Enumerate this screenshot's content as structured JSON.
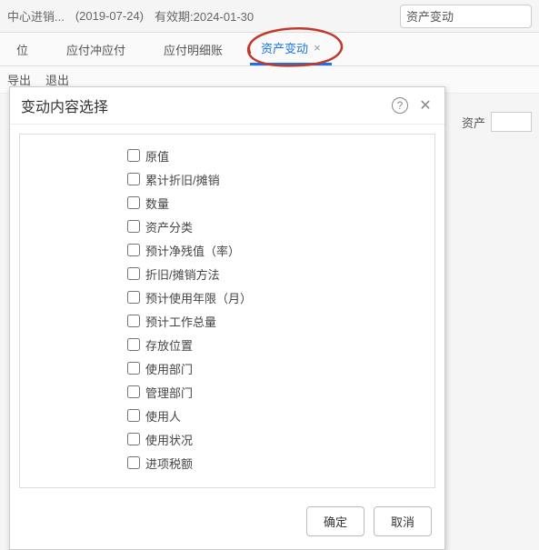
{
  "header": {
    "title_left": "中心进销...",
    "date_paren": "(2019-07-24)",
    "validity": "有效期:2024-01-30",
    "search_value": "资产变动"
  },
  "tabs": [
    {
      "label": "位",
      "active": false,
      "closable": false
    },
    {
      "label": "应付冲应付",
      "active": false,
      "closable": false
    },
    {
      "label": "应付明细账",
      "active": false,
      "closable": false
    },
    {
      "label": "资产变动",
      "active": true,
      "closable": true
    }
  ],
  "subbar": {
    "item1": "导出",
    "item2": "退出"
  },
  "form": {
    "asset_label": "资产"
  },
  "modal": {
    "title": "变动内容选择",
    "options": [
      "原值",
      "累计折旧/摊销",
      "数量",
      "资产分类",
      "预计净残值（率）",
      "折旧/摊销方法",
      "预计使用年限（月）",
      "预计工作总量",
      "存放位置",
      "使用部门",
      "管理部门",
      "使用人",
      "使用状况",
      "进项税额"
    ],
    "ok": "确定",
    "cancel": "取消"
  }
}
